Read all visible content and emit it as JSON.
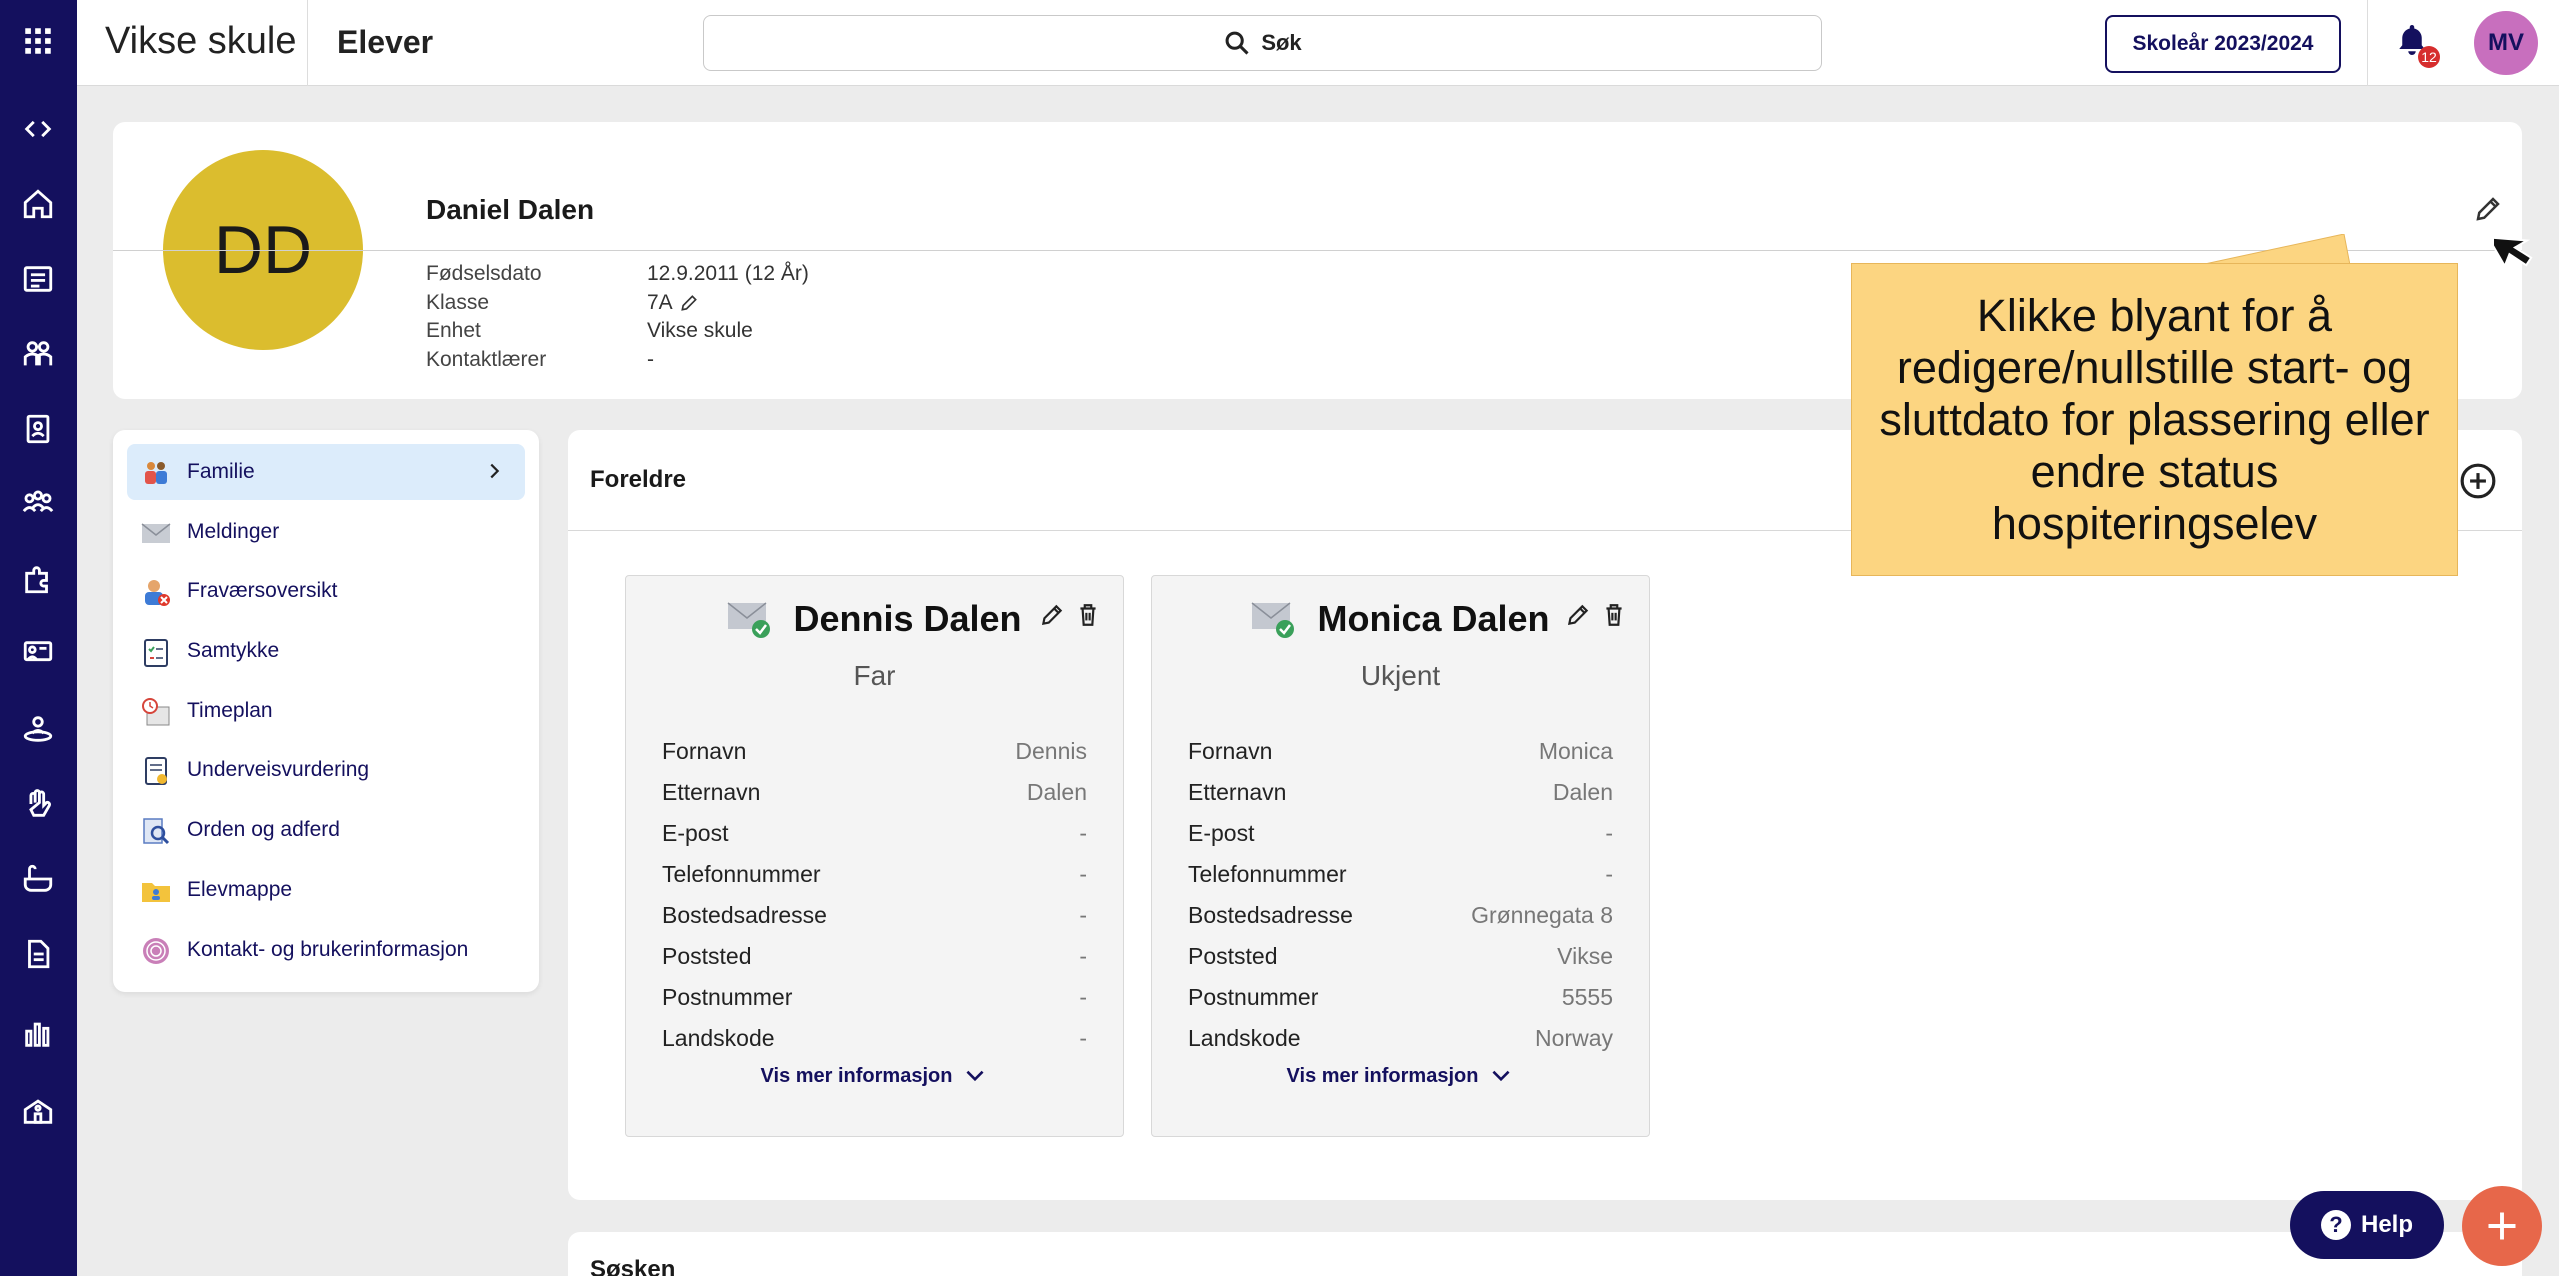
{
  "app": {
    "title": "Vikse skule",
    "page_title": "Elever"
  },
  "search": {
    "label": "Søk"
  },
  "school_year_button": "Skoleår 2023/2024",
  "notifications": {
    "count": "12"
  },
  "user_avatar": {
    "initials": "MV",
    "color": "#c86fbe"
  },
  "rail_icons": [
    "apps-grid-icon",
    "collapse-toggle-icon",
    "home-icon",
    "news-icon",
    "students-icon",
    "student-card-icon",
    "groups-icon",
    "puzzle-icon",
    "classroom-icon",
    "person-ring-icon",
    "hand-icon",
    "bath-icon",
    "document-icon",
    "bar-chart-icon",
    "school-icon"
  ],
  "student": {
    "initials": "DD",
    "avatar_color": "#dbbd2e",
    "name": "Daniel Dalen",
    "fields": [
      {
        "label": "Fødselsdato",
        "value": "12.9.2011 (12 År)"
      },
      {
        "label": "Klasse",
        "value": "7A"
      },
      {
        "label": "Enhet",
        "value": "Vikse skule"
      },
      {
        "label": "Kontaktlærer",
        "value": "-"
      }
    ]
  },
  "menu": {
    "items": [
      {
        "label": "Familie",
        "icon": "family-icon",
        "active": true
      },
      {
        "label": "Meldinger",
        "icon": "envelope-icon",
        "active": false
      },
      {
        "label": "Fraværsoversikt",
        "icon": "absence-icon",
        "active": false
      },
      {
        "label": "Samtykke",
        "icon": "clipboard-check-icon",
        "active": false
      },
      {
        "label": "Timeplan",
        "icon": "schedule-icon",
        "active": false
      },
      {
        "label": "Underveisvurdering",
        "icon": "assessment-icon",
        "active": false
      },
      {
        "label": "Orden og adferd",
        "icon": "conduct-icon",
        "active": false
      },
      {
        "label": "Elevmappe",
        "icon": "folder-icon",
        "active": false
      },
      {
        "label": "Kontakt- og brukerinformasjon",
        "icon": "contact-info-icon",
        "active": false
      }
    ]
  },
  "parents": {
    "title": "Foreldre",
    "more_label": "Vis mer informasjon",
    "cards": [
      {
        "name": "Dennis Dalen",
        "role": "Far",
        "fields": [
          {
            "label": "Fornavn",
            "value": "Dennis"
          },
          {
            "label": "Etternavn",
            "value": "Dalen"
          },
          {
            "label": "E-post",
            "value": "-"
          },
          {
            "label": "Telefonnummer",
            "value": "-"
          },
          {
            "label": "Bostedsadresse",
            "value": "-"
          },
          {
            "label": "Poststed",
            "value": "-"
          },
          {
            "label": "Postnummer",
            "value": "-"
          },
          {
            "label": "Landskode",
            "value": "-"
          }
        ]
      },
      {
        "name": "Monica Dalen",
        "role": "Ukjent",
        "fields": [
          {
            "label": "Fornavn",
            "value": "Monica"
          },
          {
            "label": "Etternavn",
            "value": "Dalen"
          },
          {
            "label": "E-post",
            "value": "-"
          },
          {
            "label": "Telefonnummer",
            "value": "-"
          },
          {
            "label": "Bostedsadresse",
            "value": "Grønnegata 8"
          },
          {
            "label": "Poststed",
            "value": "Vikse"
          },
          {
            "label": "Postnummer",
            "value": "5555"
          },
          {
            "label": "Landskode",
            "value": "Norway"
          }
        ]
      }
    ]
  },
  "siblings": {
    "title": "Søsken"
  },
  "callout": {
    "text": "Klikke blyant for å redigere/nullstille start- og sluttdato for plassering eller endre status hospiteringselev"
  },
  "help_button": {
    "label": "Help"
  },
  "colors": {
    "brand": "#14105e",
    "accent": "#e7674a",
    "callout": "#fcd581",
    "active_menu": "#dcecfb"
  }
}
